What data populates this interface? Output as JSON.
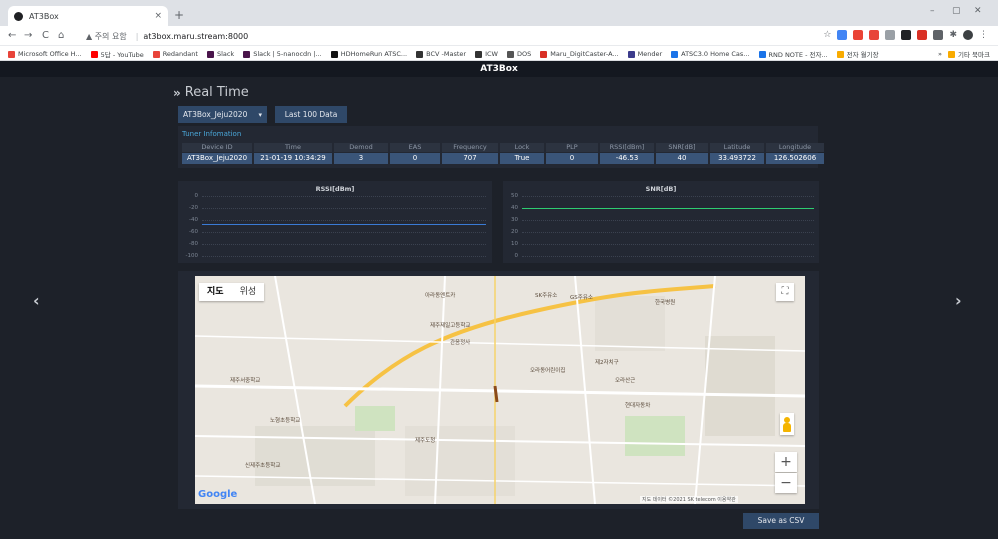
{
  "browser": {
    "tab_title": "AT3Box",
    "tab_close": "×",
    "new_tab": "+",
    "win_min": "–",
    "win_max": "▢",
    "win_close": "✕",
    "nav_back": "←",
    "nav_forward": "→",
    "nav_reload": "C",
    "nav_home": "⌂",
    "security_label": "▲ 주의 요함",
    "url": "at3box.maru.stream:8000",
    "bookmarks": [
      {
        "label": "Microsoft Office H...",
        "color": "#e8443a"
      },
      {
        "label": "5답 - YouTube",
        "color": "#ff0000"
      },
      {
        "label": "Redandant",
        "color": "#e8443a"
      },
      {
        "label": "Slack",
        "color": "#4a154b"
      },
      {
        "label": "Slack | 5-nanocdn |...",
        "color": "#4a154b"
      },
      {
        "label": "HDHomeRun ATSC...",
        "color": "#111111"
      },
      {
        "label": "BCV -Master",
        "color": "#333333"
      },
      {
        "label": "ICW",
        "color": "#333333"
      },
      {
        "label": "DOS",
        "color": "#555555"
      },
      {
        "label": "Maru_DigitCaster-A...",
        "color": "#d93025"
      },
      {
        "label": "Mender",
        "color": "#3c3c8c"
      },
      {
        "label": "ATSC3.0 Home Cas...",
        "color": "#1a73e8"
      },
      {
        "label": "RND NOTE - 전자...",
        "color": "#1a73e8"
      },
      {
        "label": "전자 월기장",
        "color": "#f9ab00"
      }
    ],
    "bookmarks_overflow": "»",
    "other_bookmarks": "기타 북마크"
  },
  "app": {
    "title": "AT3Box",
    "prev_arrow": "‹",
    "next_arrow": "›",
    "heading_chevron": "»",
    "heading": "Real Time",
    "device_select": "AT3Box_Jeju2020",
    "select_caret": "▾",
    "last100_button": "Last 100 Data",
    "tuner_title": "Tuner Infomation",
    "tuner_columns": [
      {
        "header": "Device ID",
        "value": "AT3Box_Jeju2020"
      },
      {
        "header": "Time",
        "value": "21-01-19 10:34:29"
      },
      {
        "header": "Demod",
        "value": "3"
      },
      {
        "header": "EAS",
        "value": "0"
      },
      {
        "header": "Frequency",
        "value": "707"
      },
      {
        "header": "Lock",
        "value": "True"
      },
      {
        "header": "PLP",
        "value": "0"
      },
      {
        "header": "RSSI[dBm]",
        "value": "-46.53"
      },
      {
        "header": "SNR[dB]",
        "value": "40"
      },
      {
        "header": "Latitude",
        "value": "33.493722"
      },
      {
        "header": "Longitude",
        "value": "126.502606"
      }
    ],
    "rssi_chart": {
      "title": "RSSI[dBm]",
      "ticks": [
        "0",
        "-20",
        "-40",
        "-60",
        "-80",
        "-100"
      ],
      "ylim": [
        -100,
        0
      ],
      "value": -46.53,
      "color": "#3a7bd5"
    },
    "snr_chart": {
      "title": "SNR[dB]",
      "ticks": [
        "50",
        "40",
        "30",
        "20",
        "10",
        "0"
      ],
      "ylim": [
        0,
        50
      ],
      "value": 40,
      "color": "#2ecc71"
    },
    "map": {
      "type_map": "지도",
      "type_satellite": "위성",
      "fullscreen": "⛶",
      "zoom_in": "+",
      "zoom_out": "−",
      "google": "Google",
      "attribution": "지도 데이터 ©2021 SK telecom  이용약관",
      "labels": [
        "아라동엔트카",
        "SK주유소",
        "GS주유소",
        "한국병원",
        "제주제일고등학교",
        "관음정사",
        "제2자치구",
        "오라동어린이집",
        "현대자동차",
        "제주서중학교",
        "노형초등학교",
        "제주도청",
        "신제주초등학교",
        "오라산근"
      ]
    },
    "save_csv": "Save as CSV"
  }
}
